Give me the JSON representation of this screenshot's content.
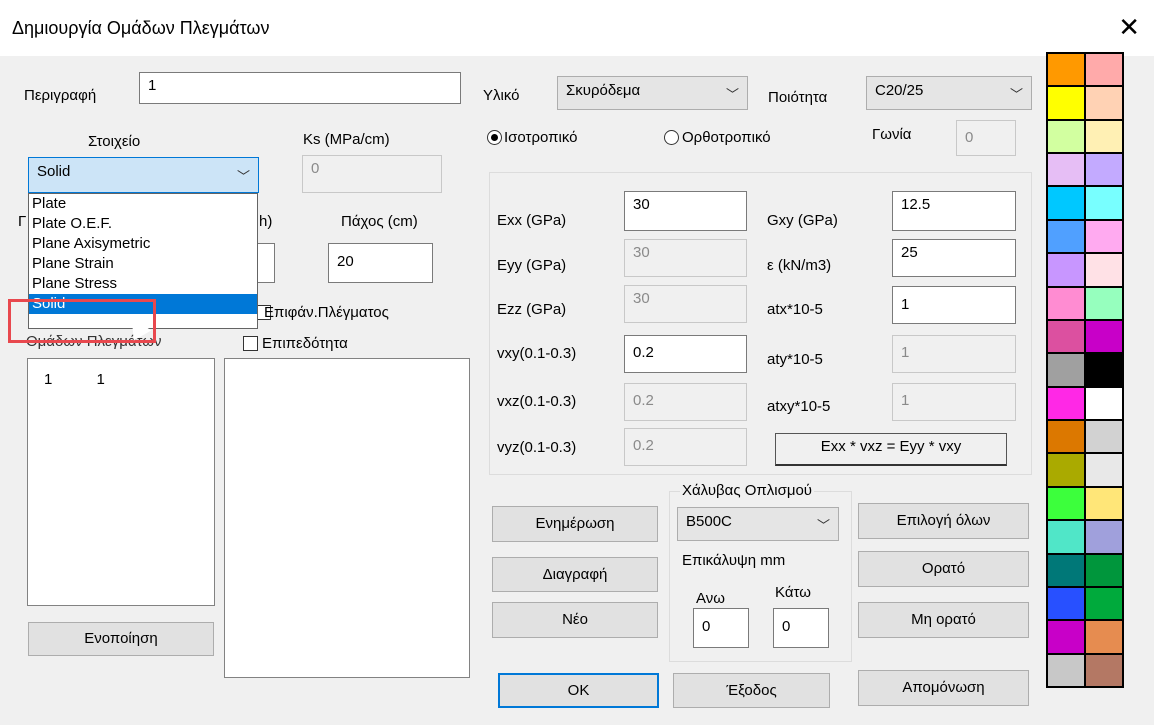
{
  "window": {
    "title": "Δημιουργία Ομάδων Πλεγμάτων",
    "close_glyph": "✕"
  },
  "left": {
    "description_label": "Περιγραφή",
    "description_value": "1",
    "element_label": "Στοιχείο",
    "ks_label": "Ks (MPa/cm)",
    "ks_value": "0",
    "element_selected": "Solid",
    "hidden_label_partial_1": "Γ",
    "hidden_label_partial_2": "h)",
    "thickness_label": "Πάχος (cm)",
    "thickness_value": "20",
    "surface_mesh_label": "Επιφάν.Πλέγματος",
    "planarity_label": "Επιπεδότητα",
    "mesh_groups_label": "Ομάδων Πλεγμάτων",
    "list_rows": [
      [
        "1",
        "1"
      ]
    ],
    "merge_button": "Ενοποίηση"
  },
  "dropdown": {
    "options": [
      "Plate",
      "Plate O.E.F.",
      "Plane Axisymetric",
      "Plane Strain",
      "Plane Stress",
      "Solid"
    ],
    "selected_index": 5
  },
  "material": {
    "material_label": "Υλικό",
    "material_value": "Σκυρόδεμα",
    "quality_label": "Ποιότητα",
    "quality_value": "C20/25",
    "isotropic_label": "Ισοτροπικό",
    "orthotropic_label": "Ορθοτροπικό",
    "isotropic_selected": true,
    "angle_label": "Γωνία",
    "angle_value": "0"
  },
  "props": {
    "exx_label": "Exx (GPa)",
    "exx_value": "30",
    "eyy_label": "Eyy (GPa)",
    "eyy_value": "30",
    "ezz_label": "Ezz (GPa)",
    "ezz_value": "30",
    "vxy_label": "vxy(0.1-0.3)",
    "vxy_value": "0.2",
    "vxz_label": "vxz(0.1-0.3)",
    "vxz_value": "0.2",
    "vyz_label": "vyz(0.1-0.3)",
    "vyz_value": "0.2",
    "gxy_label": "Gxy (GPa)",
    "gxy_value": "12.5",
    "eps_label": "ε (kN/m3)",
    "eps_value": "25",
    "atx_label": "atx*10-5",
    "atx_value": "1",
    "aty_label": "aty*10-5",
    "aty_value": "1",
    "atxy_label": "atxy*10-5",
    "atxy_value": "1",
    "formula": "Exx * vxz = Eyy * vxy"
  },
  "steel": {
    "group_label": "Χάλυβας Οπλισμού",
    "steel_value": "B500C",
    "cover_label": "Επικάλυψη mm",
    "top_label": "Ανω",
    "bottom_label": "Κάτω",
    "top_value": "0",
    "bottom_value": "0"
  },
  "buttons": {
    "update": "Ενημέρωση",
    "delete": "Διαγραφή",
    "new": "Νέο",
    "ok": "OK",
    "exit": "Έξοδος",
    "select_all": "Επιλογή όλων",
    "visible": "Ορατό",
    "not_visible": "Μη ορατό",
    "isolate": "Απομόνωση"
  },
  "palette": [
    "#ff9900",
    "#ffaaaa",
    "#ffff00",
    "#ffd2b4",
    "#d2ffa0",
    "#fff0b4",
    "#e6bef5",
    "#c3aaff",
    "#00c8ff",
    "#78ffff",
    "#50a0ff",
    "#ffaaf0",
    "#c896ff",
    "#ffe1e6",
    "#ff8cd2",
    "#96ffbe",
    "#dc50a0",
    "#c800c8",
    "#a0a0a0",
    "#000000",
    "#ff28e6",
    "#ffffff",
    "#dc7800",
    "#d2d2d2",
    "#aaaa00",
    "#e8e8e8",
    "#3cff3c",
    "#ffe678",
    "#50e6c8",
    "#a0a0dc",
    "#007878",
    "#00963c",
    "#2850ff",
    "#00aa3c",
    "#c800c8",
    "#e68c50",
    "#c8c8c8",
    "#b47864"
  ]
}
